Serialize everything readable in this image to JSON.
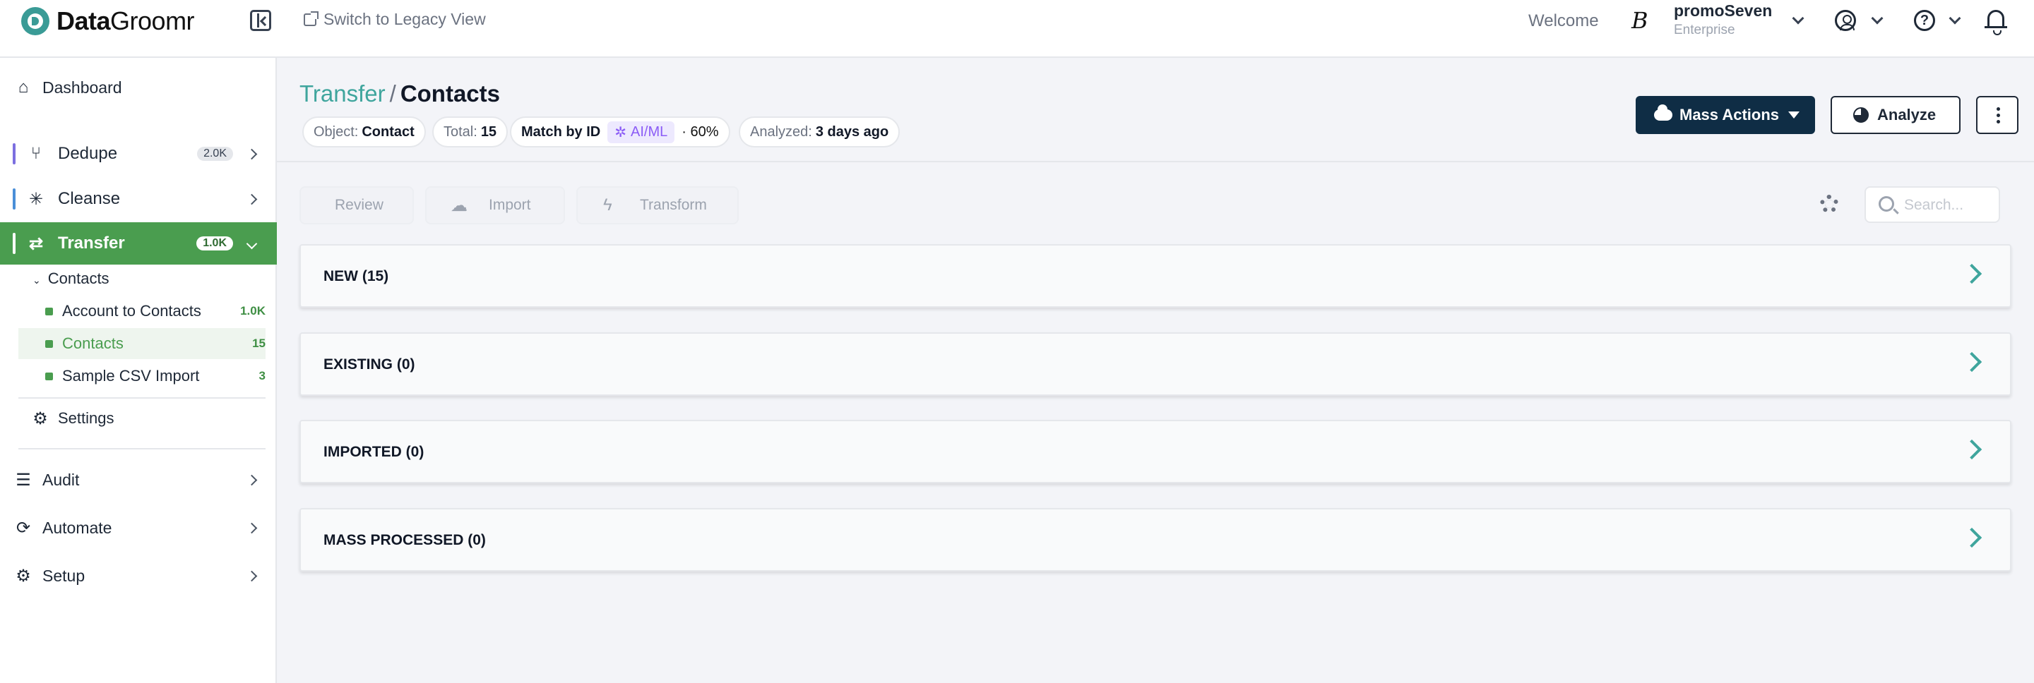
{
  "app": {
    "logo_bold": "Data",
    "logo_rest": "Groomr",
    "legacy_link": "Switch to Legacy View",
    "welcome": "Welcome",
    "org_initial": "B",
    "org_name": "promoSeven",
    "org_plan": "Enterprise"
  },
  "sidebar": {
    "dashboard": "Dashboard",
    "dedupe": {
      "label": "Dedupe",
      "count": "2.0K",
      "accent": "#7c6fe0"
    },
    "cleanse": {
      "label": "Cleanse",
      "accent": "#4a8fd8"
    },
    "transfer": {
      "label": "Transfer",
      "count": "1.0K",
      "accent": "#ffffff"
    },
    "contacts_group": "Contacts",
    "items": [
      {
        "label": "Account to Contacts",
        "count": "1.0K"
      },
      {
        "label": "Contacts",
        "count": "15"
      },
      {
        "label": "Sample CSV Import",
        "count": "3"
      }
    ],
    "settings": "Settings",
    "audit": "Audit",
    "automate": "Automate",
    "setup": "Setup"
  },
  "header": {
    "crumb": "Transfer",
    "separator": "/",
    "title": "Contacts",
    "chips": {
      "object_label": "Object:",
      "object_value": "Contact",
      "total_label": "Total:",
      "total_value": "15",
      "match_label": "Match by ID",
      "ai_label": "AI/ML",
      "match_pct": "· 60%",
      "analyzed_label": "Analyzed:",
      "analyzed_value": "3 days ago"
    },
    "mass_actions": "Mass Actions",
    "analyze": "Analyze"
  },
  "toolbar": {
    "review": "Review",
    "import": "Import",
    "transform": "Transform",
    "search_placeholder": "Search..."
  },
  "sections": [
    {
      "label": "NEW (15)"
    },
    {
      "label": "EXISTING (0)"
    },
    {
      "label": "IMPORTED (0)"
    },
    {
      "label": "MASS PROCESSED (0)"
    }
  ],
  "colors": {
    "brand_teal": "#3fa59d",
    "active_green": "#4a9d4f",
    "primary_navy": "#0f2d45",
    "ai_purple": "#8b5cf6"
  },
  "icons": [
    "home-icon",
    "dedupe-icon",
    "cleanse-icon",
    "transfer-icon",
    "settings-gear-icon",
    "audit-list-icon",
    "automate-refresh-icon",
    "setup-gear-icon",
    "user-icon",
    "help-icon",
    "bell-icon",
    "search-icon",
    "cloud-upload-icon",
    "pie-chart-icon",
    "more-vertical-icon"
  ]
}
